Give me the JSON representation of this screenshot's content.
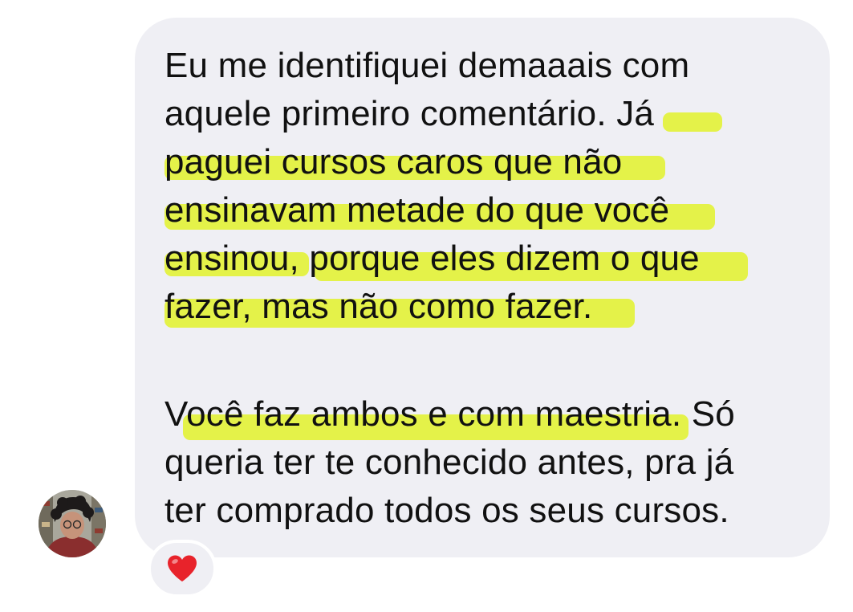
{
  "message": {
    "paragraph1": {
      "line1": "Eu me identifiquei demaaais com",
      "line2": "aquele primeiro comentário. Já",
      "line3": "paguei cursos caros que não",
      "line4": "ensinavam metade do que você",
      "line5": "ensinou, porque eles dizem o que",
      "line6": "fazer, mas não como fazer."
    },
    "paragraph2": {
      "line1": "Você faz ambos e com maestria. Só",
      "line2": "queria ter te conhecido antes, pra já",
      "line3": "ter comprado todos os seus cursos."
    }
  },
  "reaction": {
    "icon": "heart-icon",
    "color": "#e8232b"
  },
  "colors": {
    "bubble": "#efeff4",
    "highlight": "#e3f23a",
    "text": "#111111"
  }
}
